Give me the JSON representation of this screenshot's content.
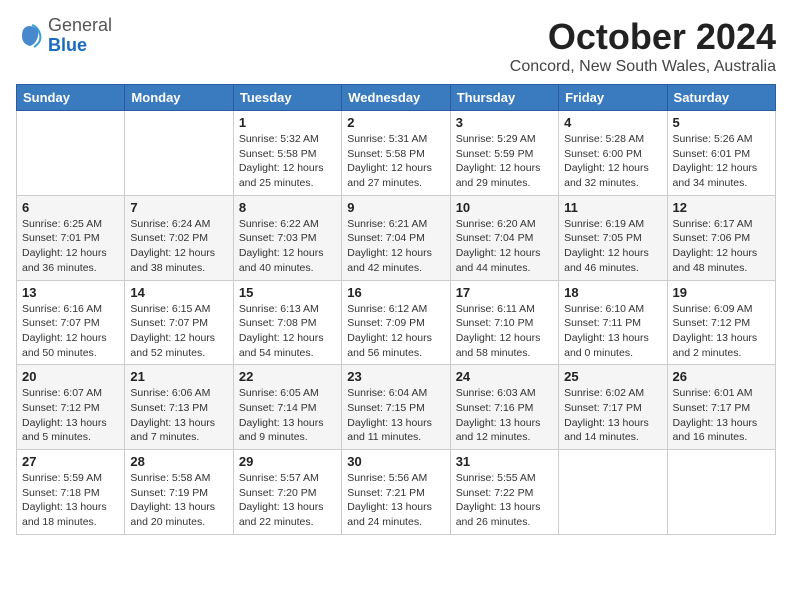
{
  "logo": {
    "general": "General",
    "blue": "Blue"
  },
  "title": "October 2024",
  "subtitle": "Concord, New South Wales, Australia",
  "weekdays": [
    "Sunday",
    "Monday",
    "Tuesday",
    "Wednesday",
    "Thursday",
    "Friday",
    "Saturday"
  ],
  "weeks": [
    [
      {
        "day": "",
        "detail": ""
      },
      {
        "day": "",
        "detail": ""
      },
      {
        "day": "1",
        "detail": "Sunrise: 5:32 AM\nSunset: 5:58 PM\nDaylight: 12 hours\nand 25 minutes."
      },
      {
        "day": "2",
        "detail": "Sunrise: 5:31 AM\nSunset: 5:58 PM\nDaylight: 12 hours\nand 27 minutes."
      },
      {
        "day": "3",
        "detail": "Sunrise: 5:29 AM\nSunset: 5:59 PM\nDaylight: 12 hours\nand 29 minutes."
      },
      {
        "day": "4",
        "detail": "Sunrise: 5:28 AM\nSunset: 6:00 PM\nDaylight: 12 hours\nand 32 minutes."
      },
      {
        "day": "5",
        "detail": "Sunrise: 5:26 AM\nSunset: 6:01 PM\nDaylight: 12 hours\nand 34 minutes."
      }
    ],
    [
      {
        "day": "6",
        "detail": "Sunrise: 6:25 AM\nSunset: 7:01 PM\nDaylight: 12 hours\nand 36 minutes."
      },
      {
        "day": "7",
        "detail": "Sunrise: 6:24 AM\nSunset: 7:02 PM\nDaylight: 12 hours\nand 38 minutes."
      },
      {
        "day": "8",
        "detail": "Sunrise: 6:22 AM\nSunset: 7:03 PM\nDaylight: 12 hours\nand 40 minutes."
      },
      {
        "day": "9",
        "detail": "Sunrise: 6:21 AM\nSunset: 7:04 PM\nDaylight: 12 hours\nand 42 minutes."
      },
      {
        "day": "10",
        "detail": "Sunrise: 6:20 AM\nSunset: 7:04 PM\nDaylight: 12 hours\nand 44 minutes."
      },
      {
        "day": "11",
        "detail": "Sunrise: 6:19 AM\nSunset: 7:05 PM\nDaylight: 12 hours\nand 46 minutes."
      },
      {
        "day": "12",
        "detail": "Sunrise: 6:17 AM\nSunset: 7:06 PM\nDaylight: 12 hours\nand 48 minutes."
      }
    ],
    [
      {
        "day": "13",
        "detail": "Sunrise: 6:16 AM\nSunset: 7:07 PM\nDaylight: 12 hours\nand 50 minutes."
      },
      {
        "day": "14",
        "detail": "Sunrise: 6:15 AM\nSunset: 7:07 PM\nDaylight: 12 hours\nand 52 minutes."
      },
      {
        "day": "15",
        "detail": "Sunrise: 6:13 AM\nSunset: 7:08 PM\nDaylight: 12 hours\nand 54 minutes."
      },
      {
        "day": "16",
        "detail": "Sunrise: 6:12 AM\nSunset: 7:09 PM\nDaylight: 12 hours\nand 56 minutes."
      },
      {
        "day": "17",
        "detail": "Sunrise: 6:11 AM\nSunset: 7:10 PM\nDaylight: 12 hours\nand 58 minutes."
      },
      {
        "day": "18",
        "detail": "Sunrise: 6:10 AM\nSunset: 7:11 PM\nDaylight: 13 hours\nand 0 minutes."
      },
      {
        "day": "19",
        "detail": "Sunrise: 6:09 AM\nSunset: 7:12 PM\nDaylight: 13 hours\nand 2 minutes."
      }
    ],
    [
      {
        "day": "20",
        "detail": "Sunrise: 6:07 AM\nSunset: 7:12 PM\nDaylight: 13 hours\nand 5 minutes."
      },
      {
        "day": "21",
        "detail": "Sunrise: 6:06 AM\nSunset: 7:13 PM\nDaylight: 13 hours\nand 7 minutes."
      },
      {
        "day": "22",
        "detail": "Sunrise: 6:05 AM\nSunset: 7:14 PM\nDaylight: 13 hours\nand 9 minutes."
      },
      {
        "day": "23",
        "detail": "Sunrise: 6:04 AM\nSunset: 7:15 PM\nDaylight: 13 hours\nand 11 minutes."
      },
      {
        "day": "24",
        "detail": "Sunrise: 6:03 AM\nSunset: 7:16 PM\nDaylight: 13 hours\nand 12 minutes."
      },
      {
        "day": "25",
        "detail": "Sunrise: 6:02 AM\nSunset: 7:17 PM\nDaylight: 13 hours\nand 14 minutes."
      },
      {
        "day": "26",
        "detail": "Sunrise: 6:01 AM\nSunset: 7:17 PM\nDaylight: 13 hours\nand 16 minutes."
      }
    ],
    [
      {
        "day": "27",
        "detail": "Sunrise: 5:59 AM\nSunset: 7:18 PM\nDaylight: 13 hours\nand 18 minutes."
      },
      {
        "day": "28",
        "detail": "Sunrise: 5:58 AM\nSunset: 7:19 PM\nDaylight: 13 hours\nand 20 minutes."
      },
      {
        "day": "29",
        "detail": "Sunrise: 5:57 AM\nSunset: 7:20 PM\nDaylight: 13 hours\nand 22 minutes."
      },
      {
        "day": "30",
        "detail": "Sunrise: 5:56 AM\nSunset: 7:21 PM\nDaylight: 13 hours\nand 24 minutes."
      },
      {
        "day": "31",
        "detail": "Sunrise: 5:55 AM\nSunset: 7:22 PM\nDaylight: 13 hours\nand 26 minutes."
      },
      {
        "day": "",
        "detail": ""
      },
      {
        "day": "",
        "detail": ""
      }
    ]
  ]
}
